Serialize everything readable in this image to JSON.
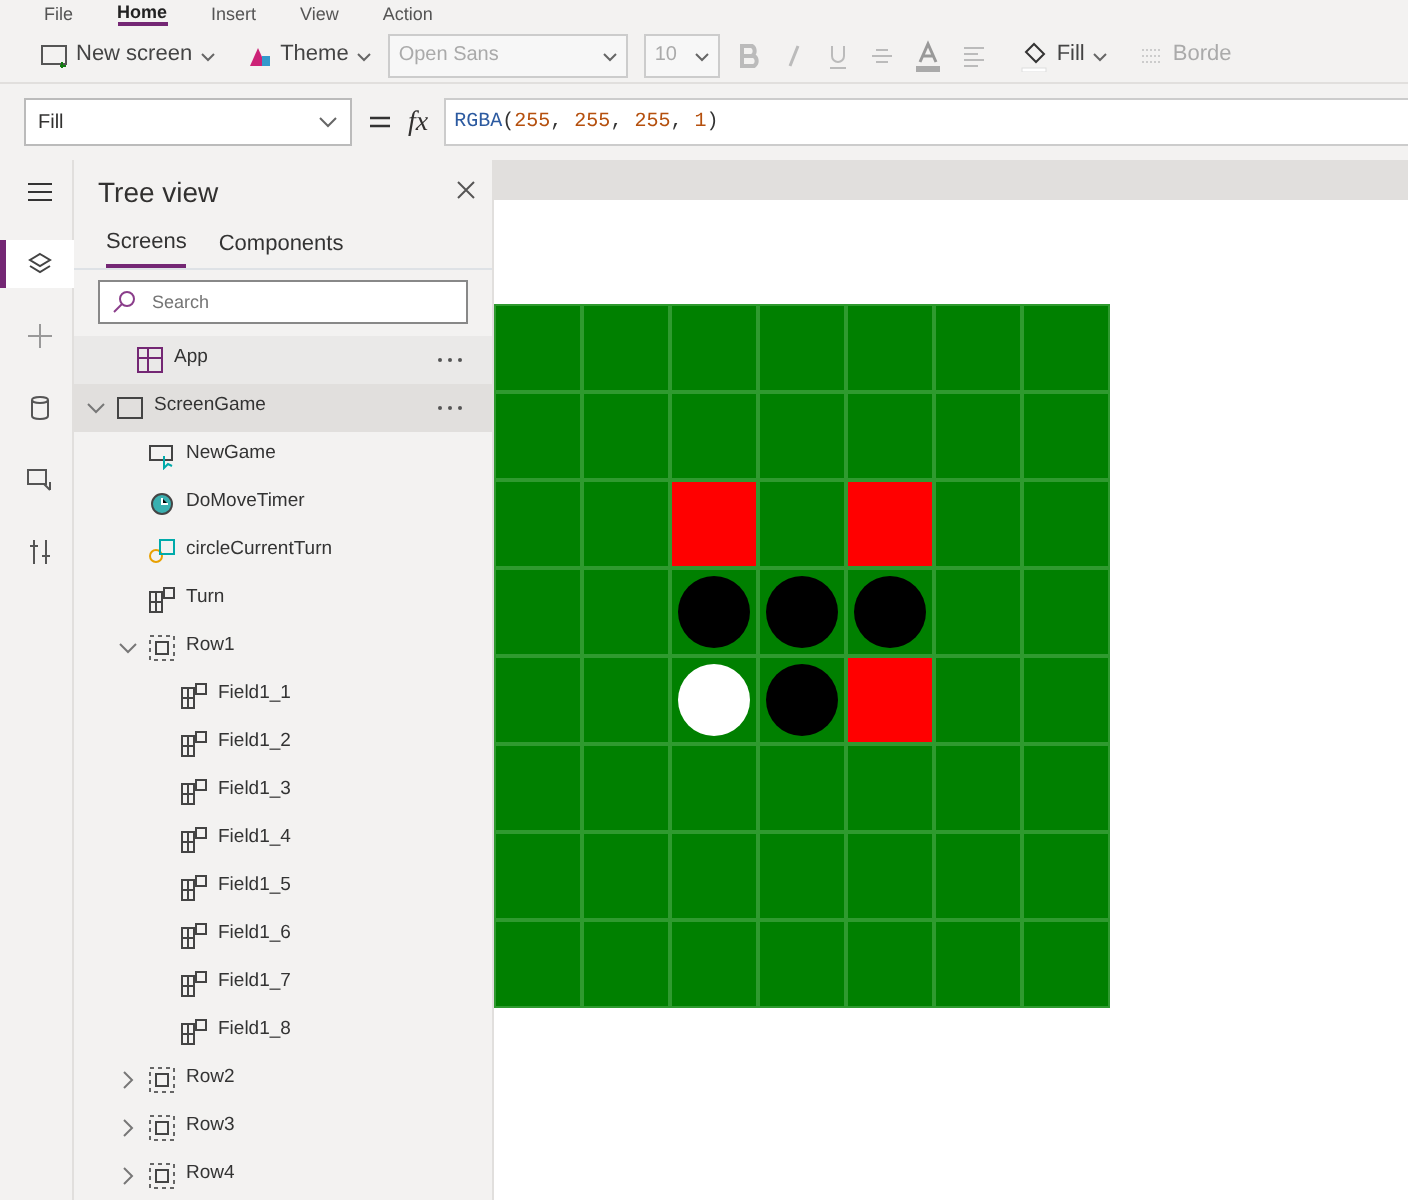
{
  "menu": [
    {
      "label": "File",
      "selected": false
    },
    {
      "label": "Home",
      "selected": true
    },
    {
      "label": "Insert",
      "selected": false
    },
    {
      "label": "View",
      "selected": false
    },
    {
      "label": "Action",
      "selected": false
    }
  ],
  "toolbar": {
    "new_screen": "New screen",
    "theme": "Theme",
    "font": "Open Sans",
    "font_size": "10",
    "fill": "Fill",
    "border": "Borde"
  },
  "formula_bar": {
    "property": "Fill",
    "fx": "fx",
    "formula": [
      {
        "kind": "func",
        "text": "RGBA"
      },
      {
        "kind": "punct",
        "text": "("
      },
      {
        "kind": "num",
        "text": "255"
      },
      {
        "kind": "punct",
        "text": ", "
      },
      {
        "kind": "num",
        "text": "255"
      },
      {
        "kind": "punct",
        "text": ", "
      },
      {
        "kind": "num",
        "text": "255"
      },
      {
        "kind": "punct",
        "text": ", "
      },
      {
        "kind": "num",
        "text": "1"
      },
      {
        "kind": "punct",
        "text": ")"
      }
    ]
  },
  "rail": [
    {
      "kind": "menu",
      "selected": false
    },
    {
      "kind": "layers",
      "selected": true
    },
    {
      "kind": "plus",
      "selected": false
    },
    {
      "kind": "data",
      "selected": false
    },
    {
      "kind": "media",
      "selected": false
    },
    {
      "kind": "tools",
      "selected": false
    }
  ],
  "tree_view": {
    "title": "Tree view",
    "tabs": [
      {
        "label": "Screens",
        "selected": true
      },
      {
        "label": "Components",
        "selected": false
      }
    ],
    "search": {
      "placeholder": "Search"
    },
    "items": [
      {
        "kind": "app",
        "label": "App",
        "selected": false,
        "more": true
      },
      {
        "kind": "screen",
        "label": "ScreenGame",
        "selected": true,
        "more": true,
        "expanded": true,
        "children": [
          {
            "kind": "button",
            "label": "NewGame"
          },
          {
            "kind": "timer",
            "label": "DoMoveTimer"
          },
          {
            "kind": "shape",
            "label": "circleCurrentTurn"
          },
          {
            "kind": "gallery",
            "label": "Turn"
          },
          {
            "kind": "group",
            "label": "Row1",
            "expanded": true,
            "children": [
              {
                "kind": "gallery",
                "label": "Field1_1"
              },
              {
                "kind": "gallery",
                "label": "Field1_2"
              },
              {
                "kind": "gallery",
                "label": "Field1_3"
              },
              {
                "kind": "gallery",
                "label": "Field1_4"
              },
              {
                "kind": "gallery",
                "label": "Field1_5"
              },
              {
                "kind": "gallery",
                "label": "Field1_6"
              },
              {
                "kind": "gallery",
                "label": "Field1_7"
              },
              {
                "kind": "gallery",
                "label": "Field1_8"
              }
            ]
          },
          {
            "kind": "group",
            "label": "Row2",
            "expanded": false
          },
          {
            "kind": "group",
            "label": "Row3",
            "expanded": false
          },
          {
            "kind": "group",
            "label": "Row4",
            "expanded": false
          }
        ]
      }
    ]
  },
  "board": [
    [
      {
        "kind": "empty"
      },
      {
        "kind": "empty"
      },
      {
        "kind": "empty"
      },
      {
        "kind": "empty"
      },
      {
        "kind": "empty"
      },
      {
        "kind": "empty"
      },
      {
        "kind": "empty"
      }
    ],
    [
      {
        "kind": "empty"
      },
      {
        "kind": "empty"
      },
      {
        "kind": "empty"
      },
      {
        "kind": "empty"
      },
      {
        "kind": "empty"
      },
      {
        "kind": "empty"
      },
      {
        "kind": "empty"
      }
    ],
    [
      {
        "kind": "empty"
      },
      {
        "kind": "empty"
      },
      {
        "kind": "red"
      },
      {
        "kind": "empty"
      },
      {
        "kind": "red"
      },
      {
        "kind": "empty"
      },
      {
        "kind": "empty"
      }
    ],
    [
      {
        "kind": "empty"
      },
      {
        "kind": "empty"
      },
      {
        "kind": "black"
      },
      {
        "kind": "black"
      },
      {
        "kind": "black"
      },
      {
        "kind": "empty"
      },
      {
        "kind": "empty"
      }
    ],
    [
      {
        "kind": "empty"
      },
      {
        "kind": "empty"
      },
      {
        "kind": "white"
      },
      {
        "kind": "black"
      },
      {
        "kind": "red"
      },
      {
        "kind": "empty"
      },
      {
        "kind": "empty"
      }
    ],
    [
      {
        "kind": "empty"
      },
      {
        "kind": "empty"
      },
      {
        "kind": "empty"
      },
      {
        "kind": "empty"
      },
      {
        "kind": "empty"
      },
      {
        "kind": "empty"
      },
      {
        "kind": "empty"
      }
    ],
    [
      {
        "kind": "empty"
      },
      {
        "kind": "empty"
      },
      {
        "kind": "empty"
      },
      {
        "kind": "empty"
      },
      {
        "kind": "empty"
      },
      {
        "kind": "empty"
      },
      {
        "kind": "empty"
      }
    ],
    [
      {
        "kind": "empty"
      },
      {
        "kind": "empty"
      },
      {
        "kind": "empty"
      },
      {
        "kind": "empty"
      },
      {
        "kind": "empty"
      },
      {
        "kind": "empty"
      },
      {
        "kind": "empty"
      }
    ]
  ]
}
